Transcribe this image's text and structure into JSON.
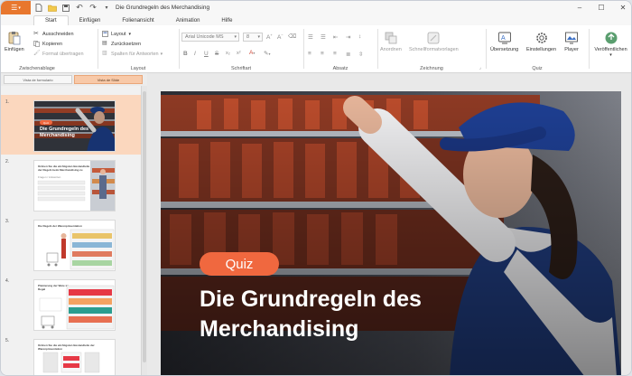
{
  "titlebar": {
    "title": "Die Grundregeln des Merchandising"
  },
  "tabs": [
    {
      "label": "Start",
      "active": true
    },
    {
      "label": "Einfügen",
      "active": false
    },
    {
      "label": "Folienansicht",
      "active": false
    },
    {
      "label": "Animation",
      "active": false
    },
    {
      "label": "Hilfe",
      "active": false
    }
  ],
  "ribbon": {
    "clipboard": {
      "paste": "Einfügen",
      "cut": "Ausschneiden",
      "copy": "Kopieren",
      "format_painter": "Format übertragen",
      "label": "Zwischenablage"
    },
    "layout": {
      "layout": "Layout",
      "reset": "Zurücksetzen",
      "answer_columns": "Spalten für Antworten",
      "label": "Layout"
    },
    "font": {
      "font_name": "Arial Unicode MS",
      "font_size": "8",
      "label": "Schriftart"
    },
    "paragraph": {
      "label": "Absatz"
    },
    "drawing": {
      "arrange": "Anordnen",
      "styles": "Schnellformatvorlagen",
      "label": "Zeichnung"
    },
    "quiz": {
      "translation": "Übersetzung",
      "settings": "Einstellungen",
      "player": "Player",
      "label": "Quiz"
    },
    "publish": {
      "label": "Veröffentlichen"
    }
  },
  "panel_tabs": {
    "form_view": "Vista de formulario",
    "slide_view": "Vista de Slide"
  },
  "slides": [
    {
      "number": "1.",
      "badge": "Quiz",
      "title": "Die Grundregeln des Merchandising"
    },
    {
      "number": "2.",
      "heading": "Ordnen Sie die wichtigsten Bestandteile der Regeln beim Merchandising zu",
      "text": "Fragen / Antworten"
    },
    {
      "number": "3.",
      "heading": "Die Regeln der Warenpräsentation"
    },
    {
      "number": "4.",
      "heading": "Platzierung der Ware im Regal"
    },
    {
      "number": "5.",
      "heading": "Ordnen Sie die wichtigsten Bestandteile der Warenpräsentation"
    }
  ],
  "main_slide": {
    "badge": "Quiz",
    "title": "Die Grundregeln des Merchandising"
  },
  "colors": {
    "accent": "#e8772e",
    "badge": "#f0683f",
    "active_thumb": "#fbd7be"
  }
}
